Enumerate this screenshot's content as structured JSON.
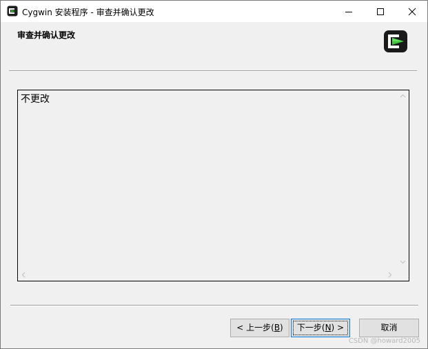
{
  "window": {
    "title": "Cygwin 安装程序 - 审查并确认更改"
  },
  "header": {
    "title": "审查并确认更改"
  },
  "content": {
    "text": "不更改"
  },
  "buttons": {
    "back_prefix": "< 上一步(",
    "back_key": "B",
    "back_suffix": ")",
    "next_prefix": "下一步(",
    "next_key": "N",
    "next_suffix": ") >",
    "cancel": "取消"
  },
  "watermark": "CSDN @howard2005",
  "colors": {
    "logo_green": "#3ec63e",
    "focus_blue": "#0078d7"
  },
  "icons": {
    "app": "cygwin-logo-icon",
    "minimize": "minimize-icon",
    "maximize": "maximize-icon",
    "close": "close-icon"
  }
}
